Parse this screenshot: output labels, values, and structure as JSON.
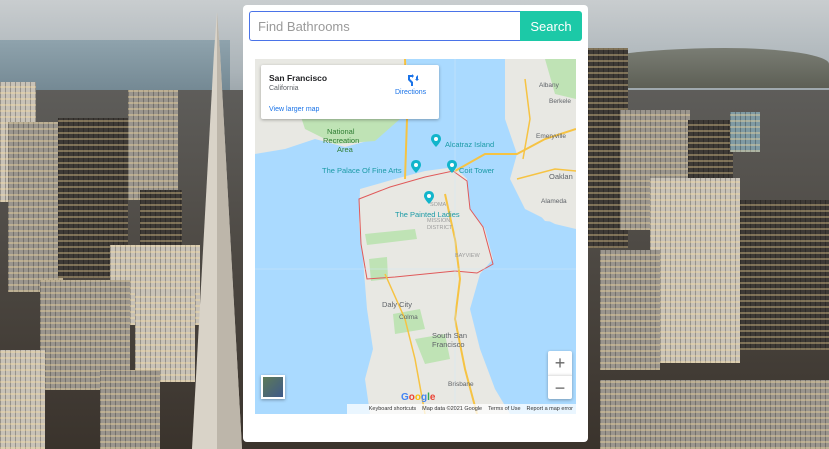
{
  "search": {
    "placeholder": "Find Bathrooms",
    "value": "",
    "button_label": "Search"
  },
  "map": {
    "info_card": {
      "title": "San Francisco",
      "subtitle": "California",
      "directions_label": "Directions",
      "larger_map_link": "View larger map"
    },
    "places": {
      "national_recreation_area": [
        "National",
        "Recreation",
        "Area"
      ],
      "alcatraz": "Alcatraz Island",
      "palace": "The Palace Of Fine Arts",
      "coit": "Coit Tower",
      "painted_ladies": "The Painted Ladies",
      "soma": "SOMA",
      "mission": [
        "MISSION",
        "DISTRICT"
      ],
      "bayview": "BAYVIEW",
      "daly_city": "Daly City",
      "colma": "Colma",
      "south_sf": [
        "South San",
        "Francisco"
      ],
      "albany": "Albany",
      "berkeley": "Berkele",
      "emeryville": "Emeryville",
      "oakland": "Oaklan",
      "alameda": "Alameda",
      "brisbane": "Brisbane"
    },
    "zoom_in": "+",
    "zoom_out": "−",
    "google": [
      "G",
      "o",
      "o",
      "g",
      "l",
      "e"
    ],
    "footer": {
      "shortcuts": "Keyboard shortcuts",
      "map_data": "Map data ©2021 Google",
      "terms": "Terms of Use",
      "report": "Report a map error"
    }
  },
  "colors": {
    "accent": "#1cc9a7",
    "water": "#aadaff",
    "land": "#e8e8e3",
    "park": "#bfe3b5",
    "boundary": "#e05a5a",
    "link": "#1a73e8"
  },
  "icons": [
    "directions-icon",
    "map-pin-icon",
    "plus-icon",
    "minus-icon"
  ]
}
